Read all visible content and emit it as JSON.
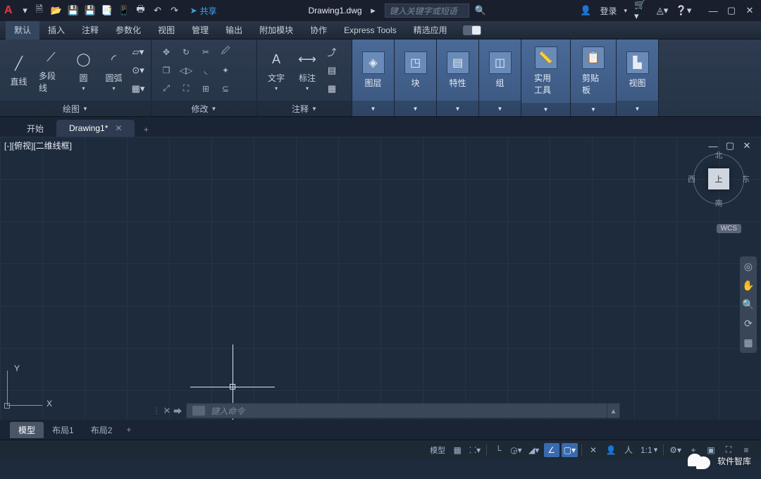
{
  "titlebar": {
    "share": "共享",
    "filename": "Drawing1.dwg",
    "search_placeholder": "键入关键字或短语",
    "login": "登录"
  },
  "ribbon_tabs": [
    "默认",
    "插入",
    "注释",
    "参数化",
    "视图",
    "管理",
    "输出",
    "附加模块",
    "协作",
    "Express Tools",
    "精选应用"
  ],
  "ribbon_active_tab": 0,
  "draw": {
    "line": "直线",
    "polyline": "多段线",
    "circle": "圆",
    "arc": "圆弧",
    "panel": "绘图"
  },
  "modify": {
    "panel": "修改"
  },
  "annotate": {
    "text": "文字",
    "dim": "标注",
    "panel": "注释"
  },
  "bluepanels": {
    "layer": "图层",
    "block": "块",
    "properties": "特性",
    "group": "组",
    "util": "实用工具",
    "clipboard": "剪贴板",
    "view": "视图"
  },
  "file_tabs": {
    "start": "开始",
    "drawing": "Drawing1*"
  },
  "viewport_label": "[-][俯视][二维线框]",
  "viewcube": {
    "top": "上",
    "n": "北",
    "s": "南",
    "w": "西",
    "e": "东",
    "wcs": "WCS"
  },
  "ucs": {
    "x": "X",
    "y": "Y"
  },
  "command_placeholder": "键入命令",
  "layouts": {
    "model": "模型",
    "l1": "布局1",
    "l2": "布局2"
  },
  "statusbar": {
    "model": "模型",
    "scale": "1:1"
  },
  "watermark": "软件智库"
}
